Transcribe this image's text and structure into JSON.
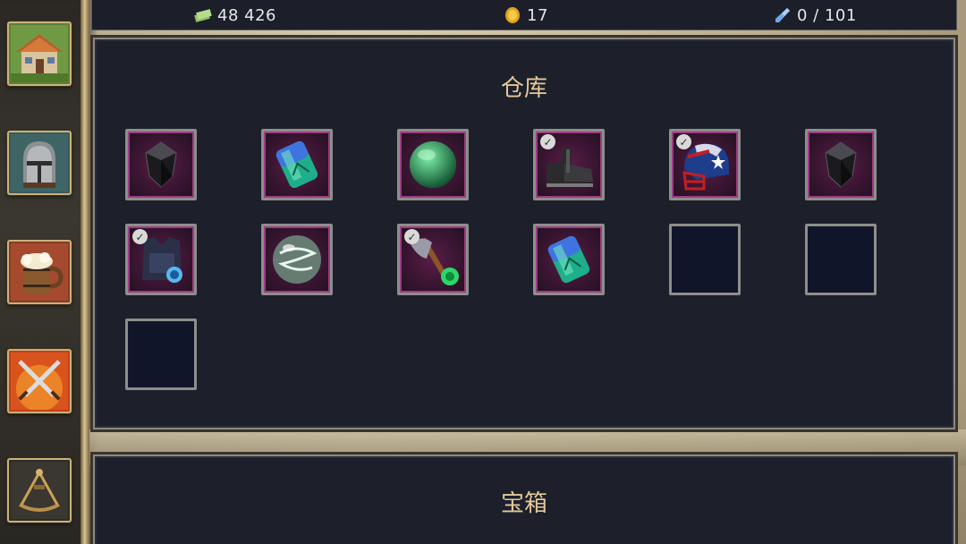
{
  "resources": {
    "cash": {
      "icon": "cash-icon",
      "value": "48 426"
    },
    "gold": {
      "icon": "gold-coin-icon",
      "value": "17"
    },
    "crystal": {
      "icon": "crystal-icon",
      "value": "0 / 101"
    }
  },
  "sidebar": [
    {
      "name": "house",
      "icon": "house-icon"
    },
    {
      "name": "knight-helmet",
      "icon": "knight-helmet-icon"
    },
    {
      "name": "tavern",
      "icon": "beer-mug-icon"
    },
    {
      "name": "battle",
      "icon": "crossed-swords-icon"
    },
    {
      "name": "expedition",
      "icon": "sextant-icon"
    }
  ],
  "warehouse": {
    "title": "仓库",
    "slots": [
      {
        "item": "black-crystal",
        "checked": false
      },
      {
        "item": "green-gem",
        "checked": false
      },
      {
        "item": "green-orb",
        "checked": false
      },
      {
        "item": "boots",
        "checked": true
      },
      {
        "item": "football-helmet",
        "checked": true
      },
      {
        "item": "black-crystal",
        "checked": false
      },
      {
        "item": "vest",
        "checked": true
      },
      {
        "item": "storm-orb",
        "checked": false
      },
      {
        "item": "axe",
        "checked": true
      },
      {
        "item": "green-gem",
        "checked": false
      },
      {
        "item": null,
        "checked": false
      },
      {
        "item": null,
        "checked": false
      },
      {
        "item": null,
        "checked": false
      }
    ]
  },
  "chest": {
    "title": "宝箱"
  },
  "colors": {
    "panel_bg": "#1d202b",
    "title": "#e4c89a",
    "slot_border": "#8e8e8c",
    "item_bg": "#3a1532"
  }
}
